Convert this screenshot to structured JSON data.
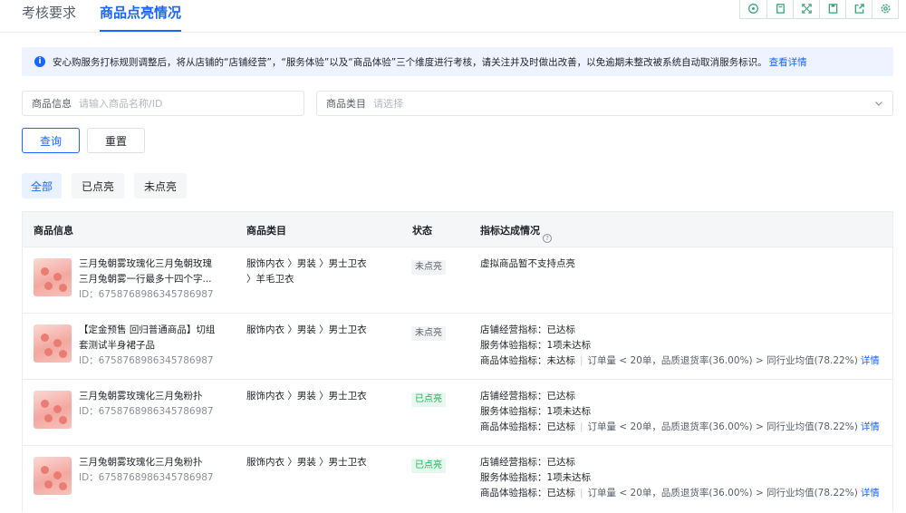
{
  "tabs": [
    {
      "label": "考核要求"
    },
    {
      "label": "商品点亮情况"
    }
  ],
  "toolbar_icons": [
    "chat-icon",
    "book-icon",
    "expand-icon",
    "save-icon",
    "share-icon",
    "settings-icon"
  ],
  "notice": {
    "icon": "info-icon",
    "message": "安心购服务打标规则调整后，将从店铺的“店铺经营”，“服务体验”以及“商品体验”三个维度进行考核，请关注并及时做出改善，以免逾期未整改被系统自动取消服务标识。",
    "link": "查看详情"
  },
  "filters": {
    "product": {
      "label": "商品信息",
      "placeholder": "请输入商品名称/ID"
    },
    "category": {
      "label": "商品类目",
      "placeholder": "请选择"
    }
  },
  "buttons": {
    "query": "查询",
    "reset": "重置"
  },
  "segments": [
    "全部",
    "已点亮",
    "未点亮"
  ],
  "table": {
    "headers": [
      "商品信息",
      "商品类目",
      "状态",
      "指标达成情况"
    ],
    "rows": [
      {
        "name": "三月兔朝雾玫瑰化三月兔朝玫瑰三月兔朝雾一行最多十四个字...",
        "id": "ID：6758768986345786987",
        "category_lines": [
          "服饰内衣 〉男装 〉男士卫衣",
          "〉羊毛卫衣"
        ],
        "status": "未点亮",
        "status_type": "off",
        "indicators": [
          {
            "label": "虚拟商品暂不支持点亮"
          }
        ]
      },
      {
        "name": "【定金预售 回归普通商品】切组套测试半身裙子品",
        "id": "ID：6758768986345786987",
        "category_lines": [
          "服饰内衣 〉男装 〉男士卫衣"
        ],
        "status": "未点亮",
        "status_type": "off",
        "indicators": [
          {
            "label": "店铺经营指标：已达标"
          },
          {
            "label": "服务体验指标：1项未达标"
          },
          {
            "label": "商品体验指标：未达标",
            "detail": "订单量 < 20单，品质退货率(36.00%) > 同行业均值(78.22%)",
            "link": "详情"
          }
        ]
      },
      {
        "name": "三月兔朝雾玫瑰化三月兔粉扑",
        "id": "ID：6758768986345786987",
        "category_lines": [
          "服饰内衣 〉男装 〉男士卫衣"
        ],
        "status": "已点亮",
        "status_type": "on",
        "indicators": [
          {
            "label": "店铺经营指标：已达标"
          },
          {
            "label": "服务体验指标：1项未达标"
          },
          {
            "label": "商品体验指标：已达标",
            "detail": "订单量 < 20单，品质退货率(36.00%) > 同行业均值(78.22%)",
            "link": "详情"
          }
        ]
      },
      {
        "name": "三月兔朝雾玫瑰化三月兔粉扑",
        "id": "ID：6758768986345786987",
        "category_lines": [
          "服饰内衣 〉男装 〉男士卫衣"
        ],
        "status": "已点亮",
        "status_type": "on",
        "indicators": [
          {
            "label": "店铺经营指标：已达标"
          },
          {
            "label": "服务体验指标：1项未达标"
          },
          {
            "label": "商品体验指标：已达标",
            "detail": "订单量 < 20单，品质退货率(36.00%) > 同行业均值(78.22%)",
            "link": "详情"
          }
        ]
      }
    ]
  }
}
